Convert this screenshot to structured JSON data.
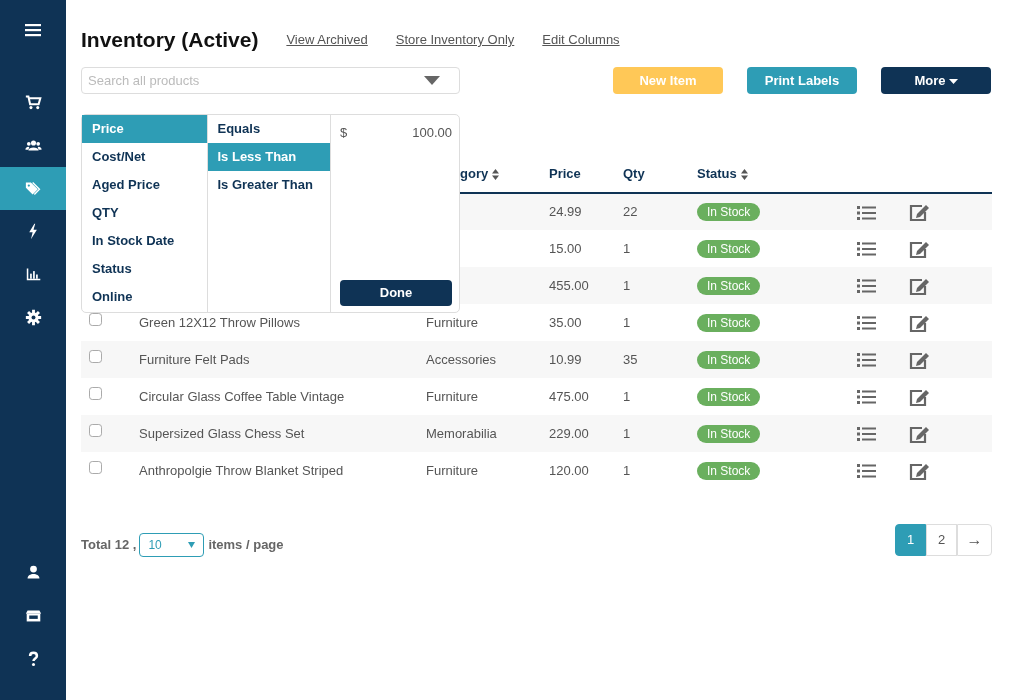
{
  "sidebar": {
    "items": [
      {
        "selected": false
      },
      {
        "selected": false
      },
      {
        "selected": true
      },
      {
        "selected": false
      },
      {
        "selected": false
      },
      {
        "selected": false
      }
    ]
  },
  "header": {
    "title": "Inventory (Active)",
    "links": [
      "View Archived",
      "Store Inventory Only",
      "Edit Columns"
    ]
  },
  "search": {
    "placeholder": "Search all products"
  },
  "buttons": [
    {
      "label": "New Item",
      "kind": "warning"
    },
    {
      "label": "Print Labels",
      "kind": "info"
    },
    {
      "label": "More",
      "kind": "dark"
    }
  ],
  "filter": {
    "fields": [
      {
        "label": "Price",
        "selected": true
      },
      {
        "label": "Cost/Net",
        "selected": false
      },
      {
        "label": "Aged Price",
        "selected": false
      },
      {
        "label": "QTY",
        "selected": false
      },
      {
        "label": "In Stock Date",
        "selected": false
      },
      {
        "label": "Status",
        "selected": false
      },
      {
        "label": "Online",
        "selected": false
      }
    ],
    "operators": [
      {
        "label": "Equals",
        "selected": false
      },
      {
        "label": "Is Less Than",
        "selected": true
      },
      {
        "label": "Is Greater Than",
        "selected": false
      }
    ],
    "currency": "$",
    "value": "100.00",
    "done": "Done"
  },
  "table": {
    "columns": [
      "gory",
      "Price",
      "Qty",
      "Status"
    ],
    "sortable": [
      true,
      false,
      false,
      true
    ],
    "rows": [
      {
        "price": "24.99",
        "qty": "22",
        "status": "In Stock"
      },
      {
        "price": "15.00",
        "qty": "1",
        "status": "In Stock"
      },
      {
        "price": "455.00",
        "qty": "1",
        "status": "In Stock"
      },
      {
        "checked": false,
        "name": "Green 12X12 Throw Pillows",
        "category": "Furniture",
        "price": "35.00",
        "qty": "1",
        "status": "In Stock"
      },
      {
        "checked": false,
        "name": "Furniture Felt Pads",
        "category": "Accessories",
        "price": "10.99",
        "qty": "35",
        "status": "In Stock"
      },
      {
        "checked": false,
        "name": "Circular Glass Coffee Table Vintage",
        "category": "Furniture",
        "price": "475.00",
        "qty": "1",
        "status": "In Stock"
      },
      {
        "checked": false,
        "name": "Supersized Glass Chess Set",
        "category": "Memorabilia",
        "price": "229.00",
        "qty": "1",
        "status": "In Stock"
      },
      {
        "checked": false,
        "name": "Anthropolgie Throw Blanket Striped",
        "category": "Furniture",
        "price": "120.00",
        "qty": "1",
        "status": "In Stock"
      }
    ]
  },
  "footer": {
    "total": "Total 12 ,",
    "per_page": "10",
    "per_page_label": "items / page"
  },
  "pagination": {
    "pages": [
      {
        "label": "1",
        "selected": true
      },
      {
        "label": "2",
        "selected": false
      }
    ],
    "next": "→"
  }
}
